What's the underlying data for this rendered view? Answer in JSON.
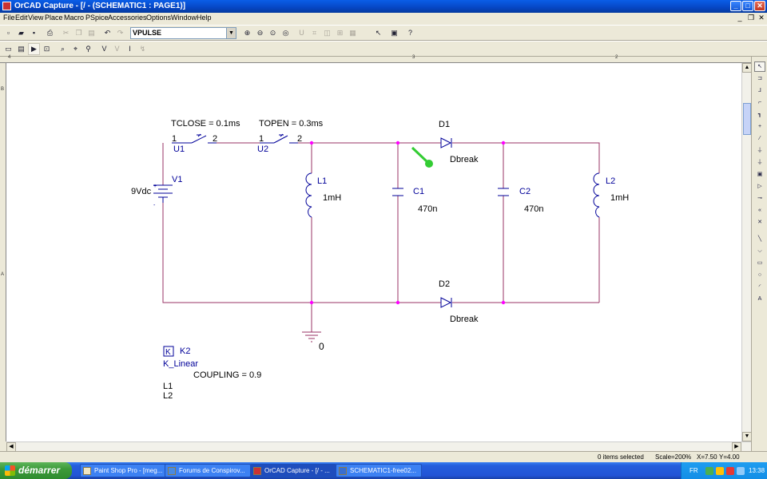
{
  "window": {
    "title": "OrCAD Capture - [/ - (SCHEMATIC1 : PAGE1)]",
    "controls": {
      "minimize": "_",
      "maximize": "□",
      "close": "✕"
    },
    "mdi_controls": {
      "minimize": "_",
      "restore": "❐",
      "close": "✕"
    }
  },
  "menu": [
    "File",
    "Edit",
    "View",
    "Place",
    "Macro",
    "PSpice",
    "Accessories",
    "Options",
    "Window",
    "Help"
  ],
  "toolbar": {
    "part_combo_value": "VPULSE"
  },
  "ruler": {
    "top_marks": [
      "4",
      "3",
      "2"
    ],
    "left_marks": [
      "B",
      "A"
    ]
  },
  "schematic": {
    "switch1": {
      "param": "TCLOSE = 0.1ms",
      "ref": "U1",
      "pin1": "1",
      "pin2": "2"
    },
    "switch2": {
      "param": "TOPEN = 0.3ms",
      "ref": "U2",
      "pin1": "1",
      "pin2": "2"
    },
    "source": {
      "ref": "V1",
      "value": "9Vdc",
      "plus": "+",
      "minus": "-"
    },
    "inductor1": {
      "ref": "L1",
      "value": "1mH"
    },
    "inductor2": {
      "ref": "L2",
      "value": "1mH"
    },
    "cap1": {
      "ref": "C1",
      "value": "470n"
    },
    "cap2": {
      "ref": "C2",
      "value": "470n"
    },
    "diode1": {
      "ref": "D1",
      "model": "Dbreak"
    },
    "diode2": {
      "ref": "D2",
      "model": "Dbreak"
    },
    "voltage_marker": {
      "label": "V"
    },
    "ground": {
      "label": "0"
    },
    "coupling": {
      "icon": "K",
      "ref": "K2",
      "model": "K_Linear",
      "param": "COUPLING = 0.9",
      "l1": "L1",
      "l2": "L2"
    },
    "colors": {
      "wire": "#993366",
      "component": "#000099",
      "junction": "#ff00ff",
      "marker": "#33cc33"
    }
  },
  "status": {
    "selection": "0 items selected",
    "scale": "Scale=200%",
    "x": "X=7.50",
    "y": "Y=4.00"
  },
  "taskbar": {
    "start_label": "démarrer",
    "tasks": [
      {
        "label": "Paint Shop Pro - [meg..."
      },
      {
        "label": "Forums de Conspirov..."
      },
      {
        "label": "OrCAD Capture - [/ - ..."
      },
      {
        "label": "SCHEMATIC1-free02..."
      }
    ],
    "language": "FR",
    "clock": "13:38"
  }
}
